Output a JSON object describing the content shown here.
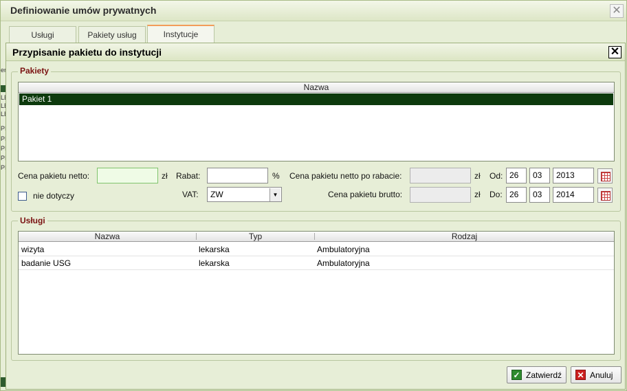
{
  "outer": {
    "title": "Definiowanie umów prywatnych",
    "close_glyph": "✕",
    "tabs": [
      {
        "label": "Usługi",
        "active": false
      },
      {
        "label": "Pakiety usług",
        "active": false
      },
      {
        "label": "Instytucje",
        "active": true
      }
    ],
    "background_strip": [
      "er",
      "LE",
      "LE",
      "LE",
      "PI",
      "PI",
      "PI",
      "PI",
      "PI"
    ]
  },
  "dialog": {
    "title": "Przypisanie pakietu do instytucji",
    "close_glyph": "✕",
    "pakiety": {
      "legend": "Pakiety",
      "column": "Nazwa",
      "rows": [
        "Pakiet 1"
      ],
      "selected_row": "Pakiet 1"
    },
    "form": {
      "cena_netto_label": "Cena pakietu netto:",
      "cena_netto_value": "",
      "currency": "zł",
      "rabat_label": "Rabat:",
      "rabat_value": "",
      "percent": "%",
      "cena_po_rabacie_label": "Cena pakietu netto po rabacie:",
      "cena_po_rabacie_value": "",
      "od_label": "Od:",
      "od_day": "26",
      "od_month": "03",
      "od_year": "2013",
      "nie_dotyczy_label": "nie dotyczy",
      "nie_dotyczy_checked": false,
      "vat_label": "VAT:",
      "vat_value": "ZW",
      "cena_brutto_label": "Cena pakietu brutto:",
      "cena_brutto_value": "",
      "do_label": "Do:",
      "do_day": "26",
      "do_month": "03",
      "do_year": "2014",
      "calendar_icon": "calendar-icon",
      "dropdown_icon": "chevron-down-icon"
    },
    "uslugi": {
      "legend": "Usługi",
      "columns": [
        "Nazwa",
        "Typ",
        "Rodzaj"
      ],
      "rows": [
        {
          "nazwa": "wizyta",
          "typ": "lekarska",
          "rodzaj": "Ambulatoryjna"
        },
        {
          "nazwa": "badanie USG",
          "typ": "lekarska",
          "rodzaj": "Ambulatoryjna"
        }
      ]
    },
    "buttons": {
      "confirm": {
        "label": "Zatwierdź",
        "icon": "check-icon",
        "color": "#2e8b2e"
      },
      "cancel": {
        "label": "Anuluj",
        "icon": "cross-icon",
        "color": "#cc1f1f"
      }
    }
  }
}
